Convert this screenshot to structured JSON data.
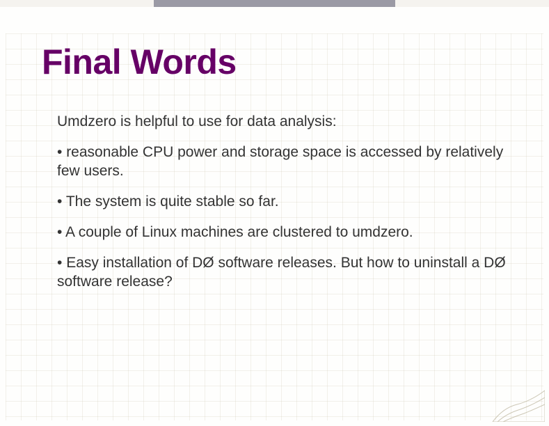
{
  "slide": {
    "title": "Final Words",
    "intro": "Umdzero is helpful to use for data analysis:",
    "bullets": [
      "reasonable CPU power and storage space is accessed by relatively few users.",
      "The system is quite stable so far.",
      "A couple of Linux machines are clustered to umdzero.",
      "Easy installation of DØ software releases. But how to uninstall a DØ software release?"
    ]
  }
}
